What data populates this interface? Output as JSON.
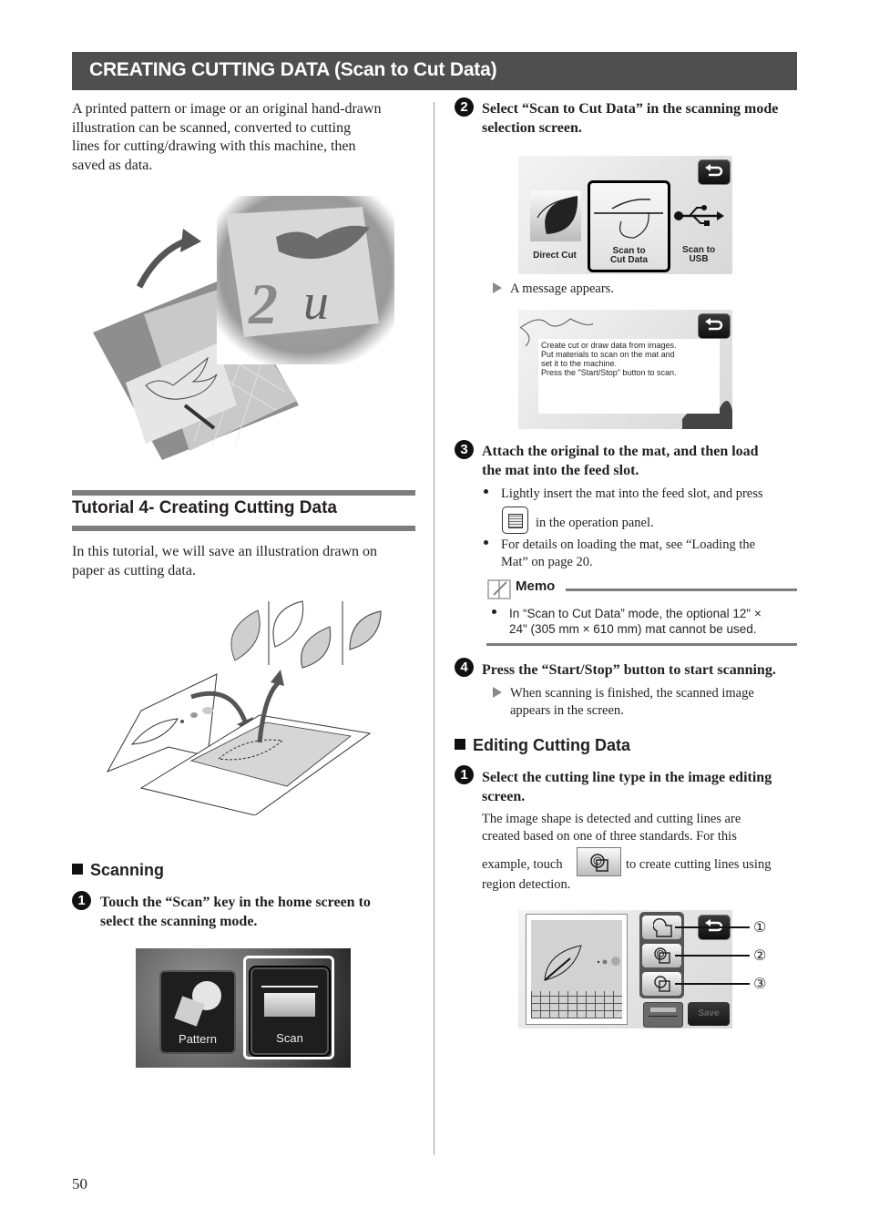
{
  "header": {
    "title": "CREATING CUTTING DATA (Scan to Cut Data)"
  },
  "intro": {
    "lines": [
      "A printed pattern or image or an original hand-drawn",
      "illustration can be scanned, converted to cutting",
      "lines for cutting/drawing with this machine, then",
      "saved as data."
    ]
  },
  "tutorial": {
    "heading": "Tutorial 4- Creating Cutting Data",
    "lines": [
      "In this tutorial, we will save an illustration drawn on",
      "paper as cutting data."
    ]
  },
  "scanning": {
    "heading": "Scanning",
    "step1": {
      "number": "1",
      "lines": [
        "Touch the “Scan” key in the home screen to",
        "select the scanning mode."
      ]
    },
    "home_screen": {
      "pattern_label": "Pattern",
      "scan_label": "Scan"
    }
  },
  "step2": {
    "number": "2",
    "lines": [
      "Select “Scan to Cut Data” in the scanning mode",
      "selection screen."
    ],
    "mode_screen": {
      "direct_cut": "Direct Cut",
      "scan_to_cut_data": [
        "Scan to",
        "Cut Data"
      ],
      "scan_to_usb": [
        "Scan to",
        "USB"
      ]
    },
    "result": "A message appears.",
    "message_screen": {
      "lines": [
        "Create cut or draw data from images.",
        "Put materials to scan on the mat and",
        "set it to the machine.",
        "Press the \"Start/Stop\" button to scan."
      ]
    }
  },
  "step3": {
    "number": "3",
    "lines": [
      "Attach the original to the mat, and then load",
      "the mat into the feed slot."
    ],
    "bullets": [
      {
        "pre": "Lightly insert the mat into the feed slot, and press",
        "post": "in the operation panel."
      },
      {
        "lines": [
          "For details on loading the mat, see “Loading the",
          "Mat” on page 20."
        ]
      }
    ],
    "memo": {
      "title": "Memo",
      "lines": [
        "In “Scan to Cut Data” mode, the optional 12\" ×",
        "24\" (305 mm × 610 mm) mat cannot be used."
      ]
    }
  },
  "step4": {
    "number": "4",
    "line": "Press the “Start/Stop” button to start scanning.",
    "result": [
      "When scanning is finished, the scanned image",
      "appears in the screen."
    ]
  },
  "editing": {
    "heading": "Editing Cutting Data",
    "step1": {
      "number": "1",
      "lines": [
        "Select the cutting line type in the image editing",
        "screen."
      ],
      "body": [
        "The image shape is detected and cutting lines are",
        "created based on one of three standards. For this"
      ],
      "example_pre": "example, touch",
      "example_post": "to create cutting lines using",
      "last_line": "region detection."
    },
    "edit_screen": {
      "save_label": "Save",
      "callouts": [
        "①",
        "②",
        "③"
      ]
    }
  },
  "footer": {
    "page_number": "50"
  }
}
